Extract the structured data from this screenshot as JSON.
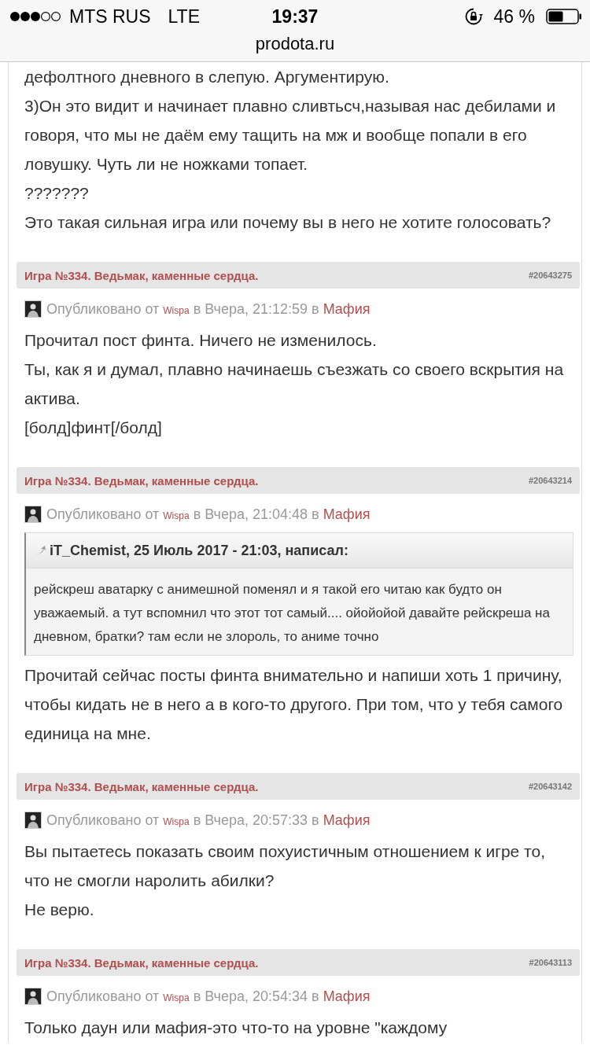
{
  "status_bar": {
    "carrier": "MTS RUS",
    "network": "LTE",
    "time": "19:37",
    "battery": "46 %"
  },
  "address_bar": {
    "url": "prodota.ru"
  },
  "top_post_body": [
    "дефолтного дневного в слепую. Аргументирую.",
    "3)Он это видит и начинает плавно сливтьсч,называя нас дебилами и говоря, что мы не даём ему тащить на мж и вообще попали в его ловушку. Чуть ли не ножками топает.",
    "???????",
    "Это такая сильная игра или почему вы в него не хотите голосовать?"
  ],
  "posts": [
    {
      "topic": "Игра №334. Ведьмак, каменные сердца.",
      "post_id": "#20643275",
      "published": "Опубликовано от",
      "author": "Wispa",
      "date": "в Вчера, 21:12:59 в",
      "forum": "Мафия",
      "body": [
        "Прочитал пост финта. Ничего не изменилось.",
        "Ты, как я и думал, плавно начинаешь съезжать со своего вскрытия на актива.",
        "[болд]финт[/болд]"
      ]
    },
    {
      "topic": "Игра №334. Ведьмак, каменные сердца.",
      "post_id": "#20643214",
      "published": "Опубликовано от",
      "author": "Wispa",
      "date": "в Вчера, 21:04:48 в",
      "forum": "Мафия",
      "quote": {
        "title": "iT_Chemist, 25 Июль 2017 - 21:03, написал:",
        "text": "рейскреш аватарку с анимешной поменял и я такой его читаю как будто он уважаемый. а тут вспомнил что этот тот самый.... ойойойой давайте рейскреша на дневном, братки? там если не злороль, то аниме точно"
      },
      "body": [
        "Прочитай сейчас посты финта внимательно и напиши хоть 1 причину, чтобы кидать не в него а в кого-то другого. При том, что у тебя самого единица на мне."
      ]
    },
    {
      "topic": "Игра №334. Ведьмак, каменные сердца.",
      "post_id": "#20643142",
      "published": "Опубликовано от",
      "author": "Wispa",
      "date": "в Вчера, 20:57:33 в",
      "forum": "Мафия",
      "body": [
        "Вы пытаетесь показать своим похуистичным отношением к игре то, что не смогли наролить абилки?",
        "Не верю."
      ]
    },
    {
      "topic": "Игра №334. Ведьмак, каменные сердца.",
      "post_id": "#20643113",
      "published": "Опубликовано от",
      "author": "Wispa",
      "date": "в Вчера, 20:54:34 в",
      "forum": "Мафия",
      "body": [
        "Только даун или мафия-это что-то на уровне \"каждому"
      ]
    }
  ]
}
